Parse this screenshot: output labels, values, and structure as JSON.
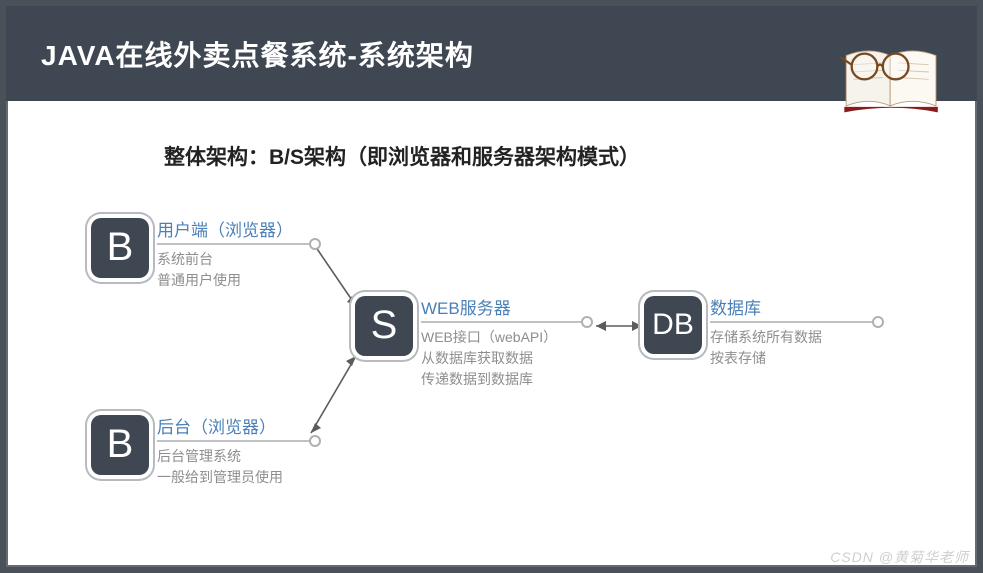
{
  "header": {
    "title": "JAVA在线外卖点餐系统-系统架构"
  },
  "subtitle": "整体架构：B/S架构（即浏览器和服务器架构模式）",
  "nodes": {
    "client": {
      "box_label": "B",
      "title": "用户端（浏览器）",
      "desc_line1": "系统前台",
      "desc_line2": "普通用户使用"
    },
    "admin": {
      "box_label": "B",
      "title": "后台（浏览器）",
      "desc_line1": "后台管理系统",
      "desc_line2": "一般给到管理员使用"
    },
    "server": {
      "box_label": "S",
      "title": "WEB服务器",
      "desc_line1": "WEB接口（webAPI）",
      "desc_line2": "从数据库获取数据",
      "desc_line3": "传递数据到数据库"
    },
    "db": {
      "box_label": "DB",
      "title": "数据库",
      "desc_line1": "存储系统所有数据",
      "desc_line2": "按表存储"
    }
  },
  "watermark": "CSDN @黄菊华老师"
}
